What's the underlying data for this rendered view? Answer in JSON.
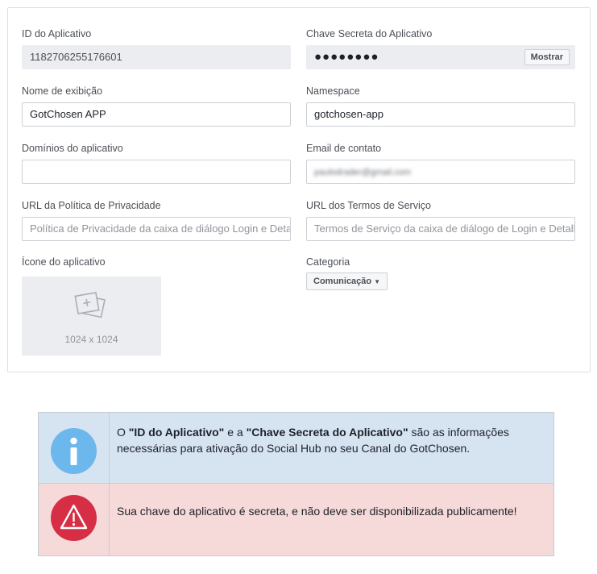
{
  "form": {
    "app_id": {
      "label": "ID do Aplicativo",
      "value": "1182706255176601"
    },
    "app_secret": {
      "label": "Chave Secreta do Aplicativo",
      "value": "●●●●●●●●",
      "show_button": "Mostrar"
    },
    "display_name": {
      "label": "Nome de exibição",
      "value": "GotChosen APP"
    },
    "namespace": {
      "label": "Namespace",
      "value": "gotchosen-app"
    },
    "app_domains": {
      "label": "Domínios do aplicativo",
      "value": ""
    },
    "contact_email": {
      "label": "Email de contato",
      "value": "paulodrader@gmail.com"
    },
    "privacy_url": {
      "label": "URL da Política de Privacidade",
      "placeholder": "Política de Privacidade da caixa de diálogo Login e Detalhes do Aplicativo"
    },
    "terms_url": {
      "label": "URL dos Termos de Serviço",
      "placeholder": "Termos de Serviço da caixa de diálogo de Login e Detalhes do Aplicativo"
    },
    "app_icon": {
      "label": "Ícone do aplicativo",
      "dimensions": "1024 x 1024"
    },
    "category": {
      "label": "Categoria",
      "value": "Comunicação"
    }
  },
  "notices": {
    "info": {
      "part1": "O ",
      "bold1": "\"ID do Aplicativo\"",
      "part2": " e a ",
      "bold2": "\"Chave Secreta do Aplicativo\"",
      "part3": " são as informações necessárias para ativação do Social Hub no seu Canal do GotChosen."
    },
    "warning": {
      "text": "Sua chave do aplicativo é secreta, e não deve ser disponibilizada publicamente!"
    }
  },
  "colors": {
    "info_bg": "#d6e4f2",
    "info_icon": "#6cb7ec",
    "warn_bg": "#f6d9d9",
    "warn_icon": "#d62e44"
  }
}
